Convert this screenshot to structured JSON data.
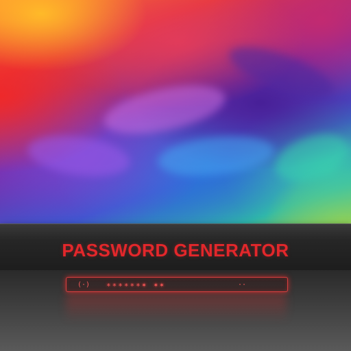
{
  "app": {
    "title": "PASSWORD GENERATOR"
  },
  "password_field": {
    "icon": "key-icon",
    "icon_glyph": "(·)",
    "value": "∗∗∗∗∗∗✶ ✶✶",
    "trailing": "··"
  },
  "colors": {
    "title": "#e3272b",
    "glow": "#ff2a2a",
    "panel": "#262626"
  }
}
